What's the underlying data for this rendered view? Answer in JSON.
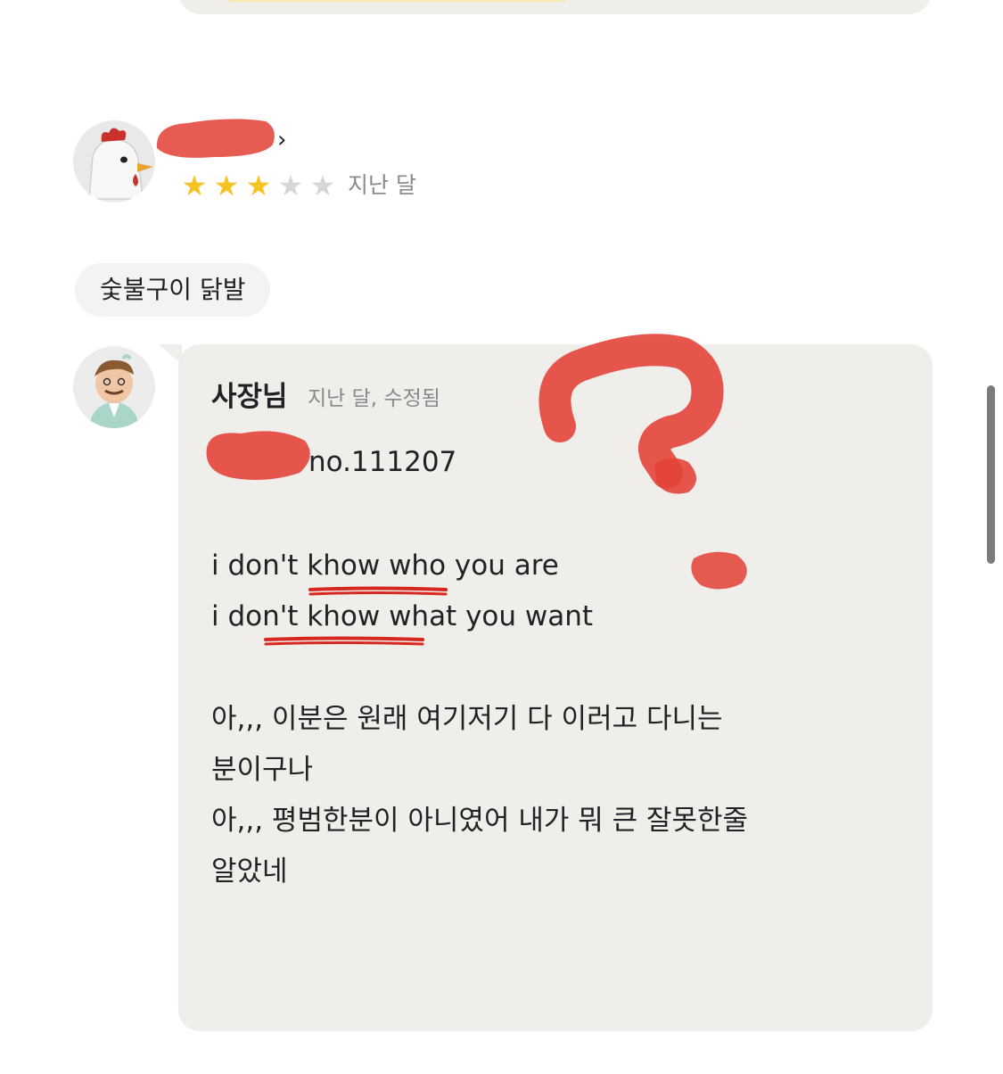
{
  "review": {
    "rating": 3,
    "rating_max": 5,
    "date": "지난 달",
    "chevron": "›",
    "menu_tag": "숯불구이 닭발",
    "avatar_icon": "chicken-avatar-icon"
  },
  "reply": {
    "author": "사장님",
    "meta": "지난 달, 수정됨",
    "order_no": "no.111207",
    "lines": [
      "i don't khow who you are",
      "i don't khow what you want",
      "아,,, 이분은 원래 여기저기 다 이러고 다니는",
      "분이구나",
      "아,,, 평범한분이 아니였어 내가 뭐 큰 잘못한줄",
      "알았네"
    ],
    "avatar_icon": "chef-avatar-icon"
  },
  "colors": {
    "card_bg": "#efeeea",
    "star_on": "#f5c324",
    "star_off": "#d6d6d6",
    "annotation_red": "#e3312b"
  }
}
